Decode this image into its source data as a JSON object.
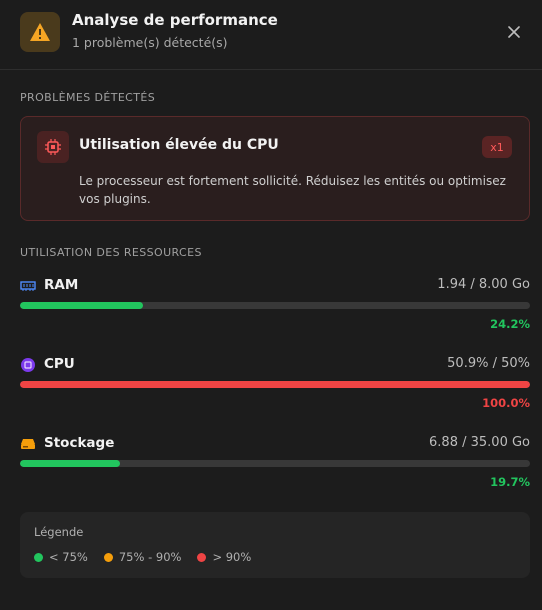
{
  "header": {
    "title": "Analyse de performance",
    "subtitle": "1 problème(s) détecté(s)",
    "warning_icon": "warning-triangle-icon",
    "close_icon": "close-icon"
  },
  "issues_section": {
    "label": "PROBLÈMES DÉTECTÉS",
    "items": [
      {
        "icon": "cpu-chip-icon",
        "title": "Utilisation élevée du CPU",
        "badge": "x1",
        "description": "Le processeur est fortement sollicité. Réduisez les entités ou optimisez vos plugins."
      }
    ]
  },
  "resources_section": {
    "label": "UTILISATION DES RESSOURCES",
    "items": [
      {
        "name": "RAM",
        "icon": "ram-icon",
        "value": "1.94 / 8.00 Go",
        "percent_text": "24.2%",
        "fraction": 0.242,
        "status_color": "#22c55e"
      },
      {
        "name": "CPU",
        "icon": "cpu-icon",
        "value": "50.9% / 50%",
        "percent_text": "100.0%",
        "fraction": 1.0,
        "status_color": "#ef4444"
      },
      {
        "name": "Stockage",
        "icon": "storage-icon",
        "value": "6.88 / 35.00 Go",
        "percent_text": "19.7%",
        "fraction": 0.197,
        "status_color": "#22c55e"
      }
    ]
  },
  "legend": {
    "title": "Légende",
    "items": [
      {
        "label": "< 75%",
        "color": "#22c55e"
      },
      {
        "label": "75% - 90%",
        "color": "#f59e0b"
      },
      {
        "label": "> 90%",
        "color": "#ef4444"
      }
    ]
  },
  "colors": {
    "accent_warning": "#f5a524",
    "danger": "#ef4444",
    "ok": "#22c55e",
    "ram_icon": "#4f8cff",
    "cpu_icon": "#a855f7",
    "storage_icon": "#f59e0b"
  }
}
